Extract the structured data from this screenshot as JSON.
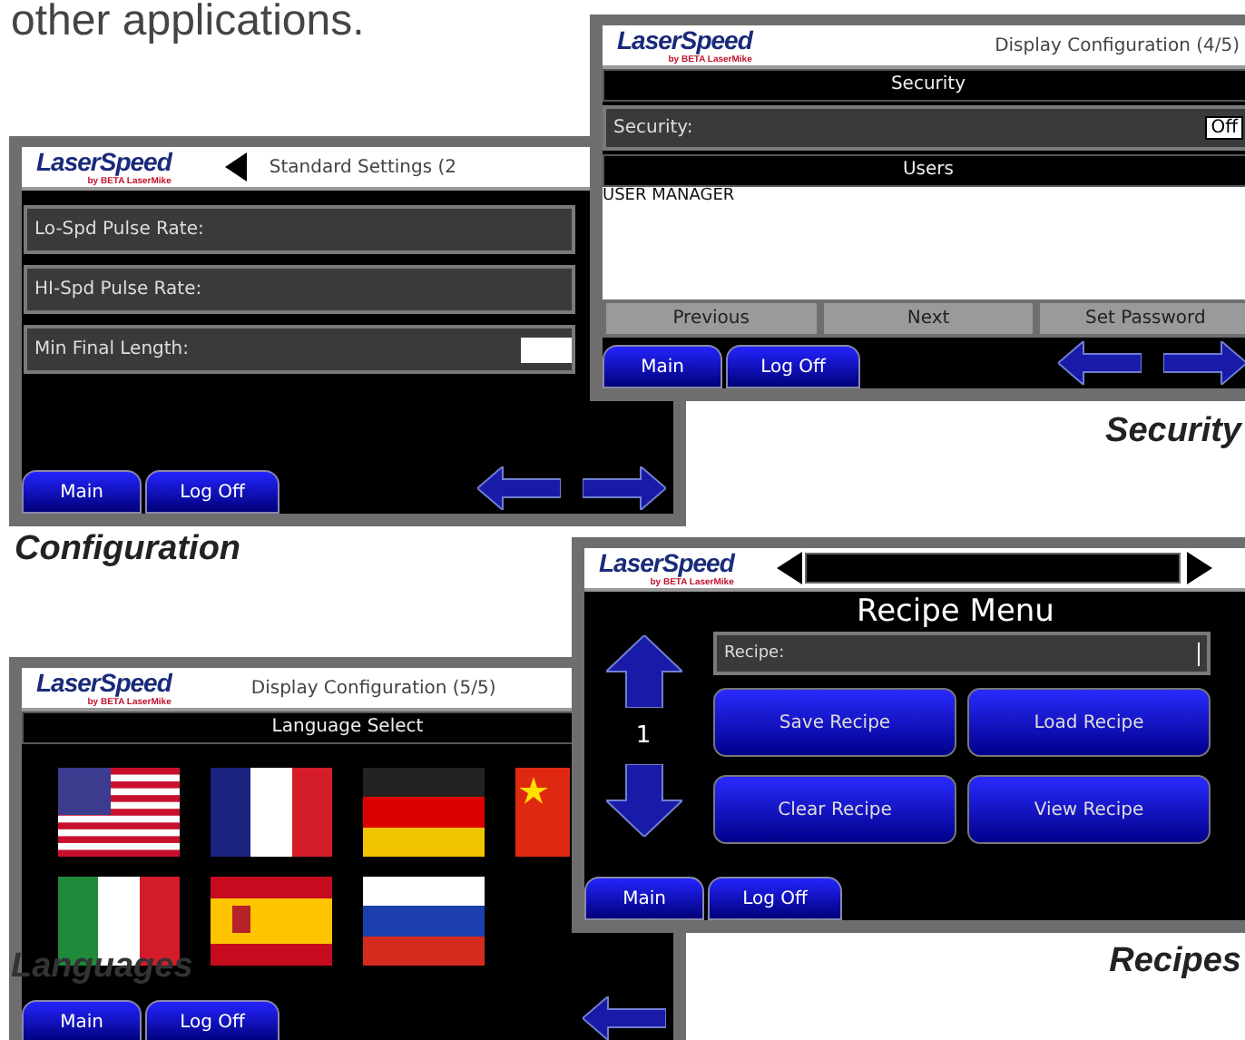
{
  "intro_text": "other applications.",
  "configuration_screen": {
    "logo": "LaserSpeed",
    "logo_sub": "by BETA LaserMike",
    "back_marker": true,
    "title": "Standard Settings (2",
    "rows": [
      {
        "label": "Lo-Spd Pulse Rate:",
        "has_field": false
      },
      {
        "label": "HI-Spd Pulse Rate:",
        "has_field": false
      },
      {
        "label": "Min Final Length:",
        "has_field": true
      }
    ],
    "nav_buttons": [
      "Main",
      "Log Off"
    ],
    "nav_arrows": [
      {
        "kind": "left"
      },
      {
        "kind": "right"
      }
    ]
  },
  "configuration_caption": "Configuration",
  "security_screen": {
    "logo": "LaserSpeed",
    "logo_sub": "by BETA LaserMike",
    "title": "Display Configuration (4/5)",
    "section": "Security",
    "setting_label": "Security:",
    "setting_value": "Off",
    "users_section": "Users",
    "users": [
      "USER MANAGER"
    ],
    "buttons": [
      "Previous",
      "Next",
      "Set Password"
    ],
    "nav_buttons": [
      "Main",
      "Log Off"
    ],
    "nav_arrows": [
      {
        "kind": "left"
      },
      {
        "kind": "right"
      }
    ]
  },
  "security_caption": "Security",
  "languages_screen": {
    "logo": "LaserSpeed",
    "logo_sub": "by BETA LaserMike",
    "title": "Display Configuration (5/5)",
    "section": "Language Select",
    "flags": [
      {
        "kind": "us"
      },
      {
        "kind": "fr"
      },
      {
        "kind": "de"
      },
      {
        "kind": "cn"
      },
      {
        "kind": "it"
      },
      {
        "kind": "es"
      },
      {
        "kind": "ru"
      }
    ],
    "nav_buttons": [
      "Main",
      "Log Off"
    ],
    "nav_arrows": [
      {
        "kind": "left"
      }
    ]
  },
  "languages_caption": "Languages",
  "recipes_screen": {
    "logo": "LaserSpeed",
    "logo_sub": "by BETA LaserMike",
    "title": "Recipe Menu",
    "field_label": "Recipe:",
    "counter": "1",
    "buttons": [
      "Save Recipe",
      "Load Recipe",
      "Clear Recipe",
      "View Recipe"
    ],
    "nav_buttons": [
      "Main",
      "Log Off"
    ]
  },
  "recipes_caption": "Recipes"
}
